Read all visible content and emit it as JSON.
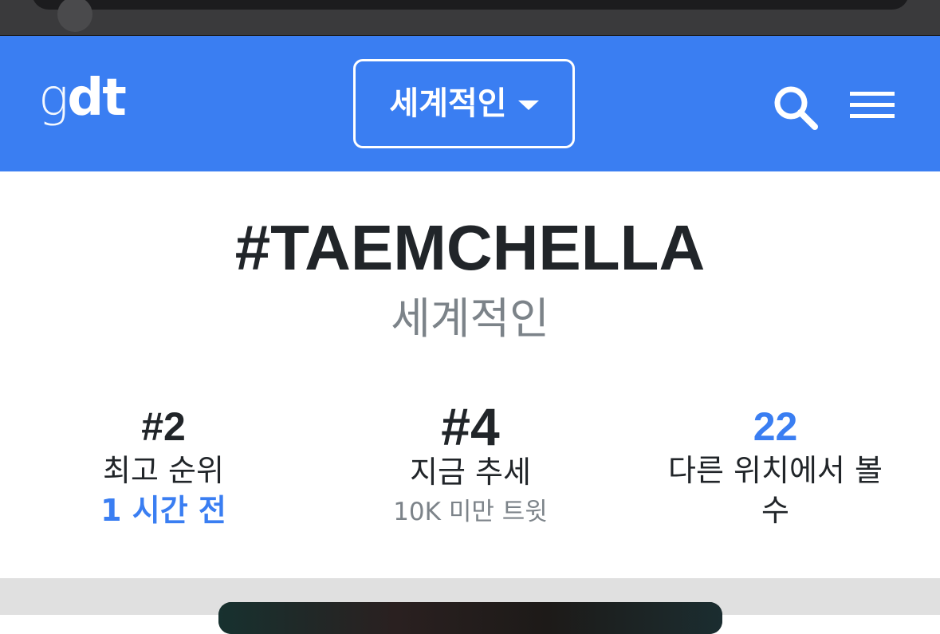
{
  "brand": {
    "logo_light": "g",
    "logo_bold": "dt",
    "color": "#3a7ef2"
  },
  "navbar": {
    "location_selected": "세계적인",
    "search_icon": "search-icon",
    "menu_icon": "hamburger-menu-icon"
  },
  "trend": {
    "hashtag": "#TAEMCHELLA",
    "location": "세계적인"
  },
  "stats": {
    "top_rank": {
      "value": "#2",
      "caption": "최고 순위",
      "time_ago": "1 시간 전"
    },
    "now": {
      "value": "#4",
      "caption": "지금 추세",
      "tweets": "10K 미만 트윗"
    },
    "locations": {
      "value": "22",
      "caption_line1": "다른 위치에서 볼",
      "caption_line2": "수"
    }
  },
  "colors": {
    "accent": "#3a7ef2",
    "text_dark": "#212529",
    "text_muted": "#7c8389",
    "band": "#e0e0e0"
  }
}
